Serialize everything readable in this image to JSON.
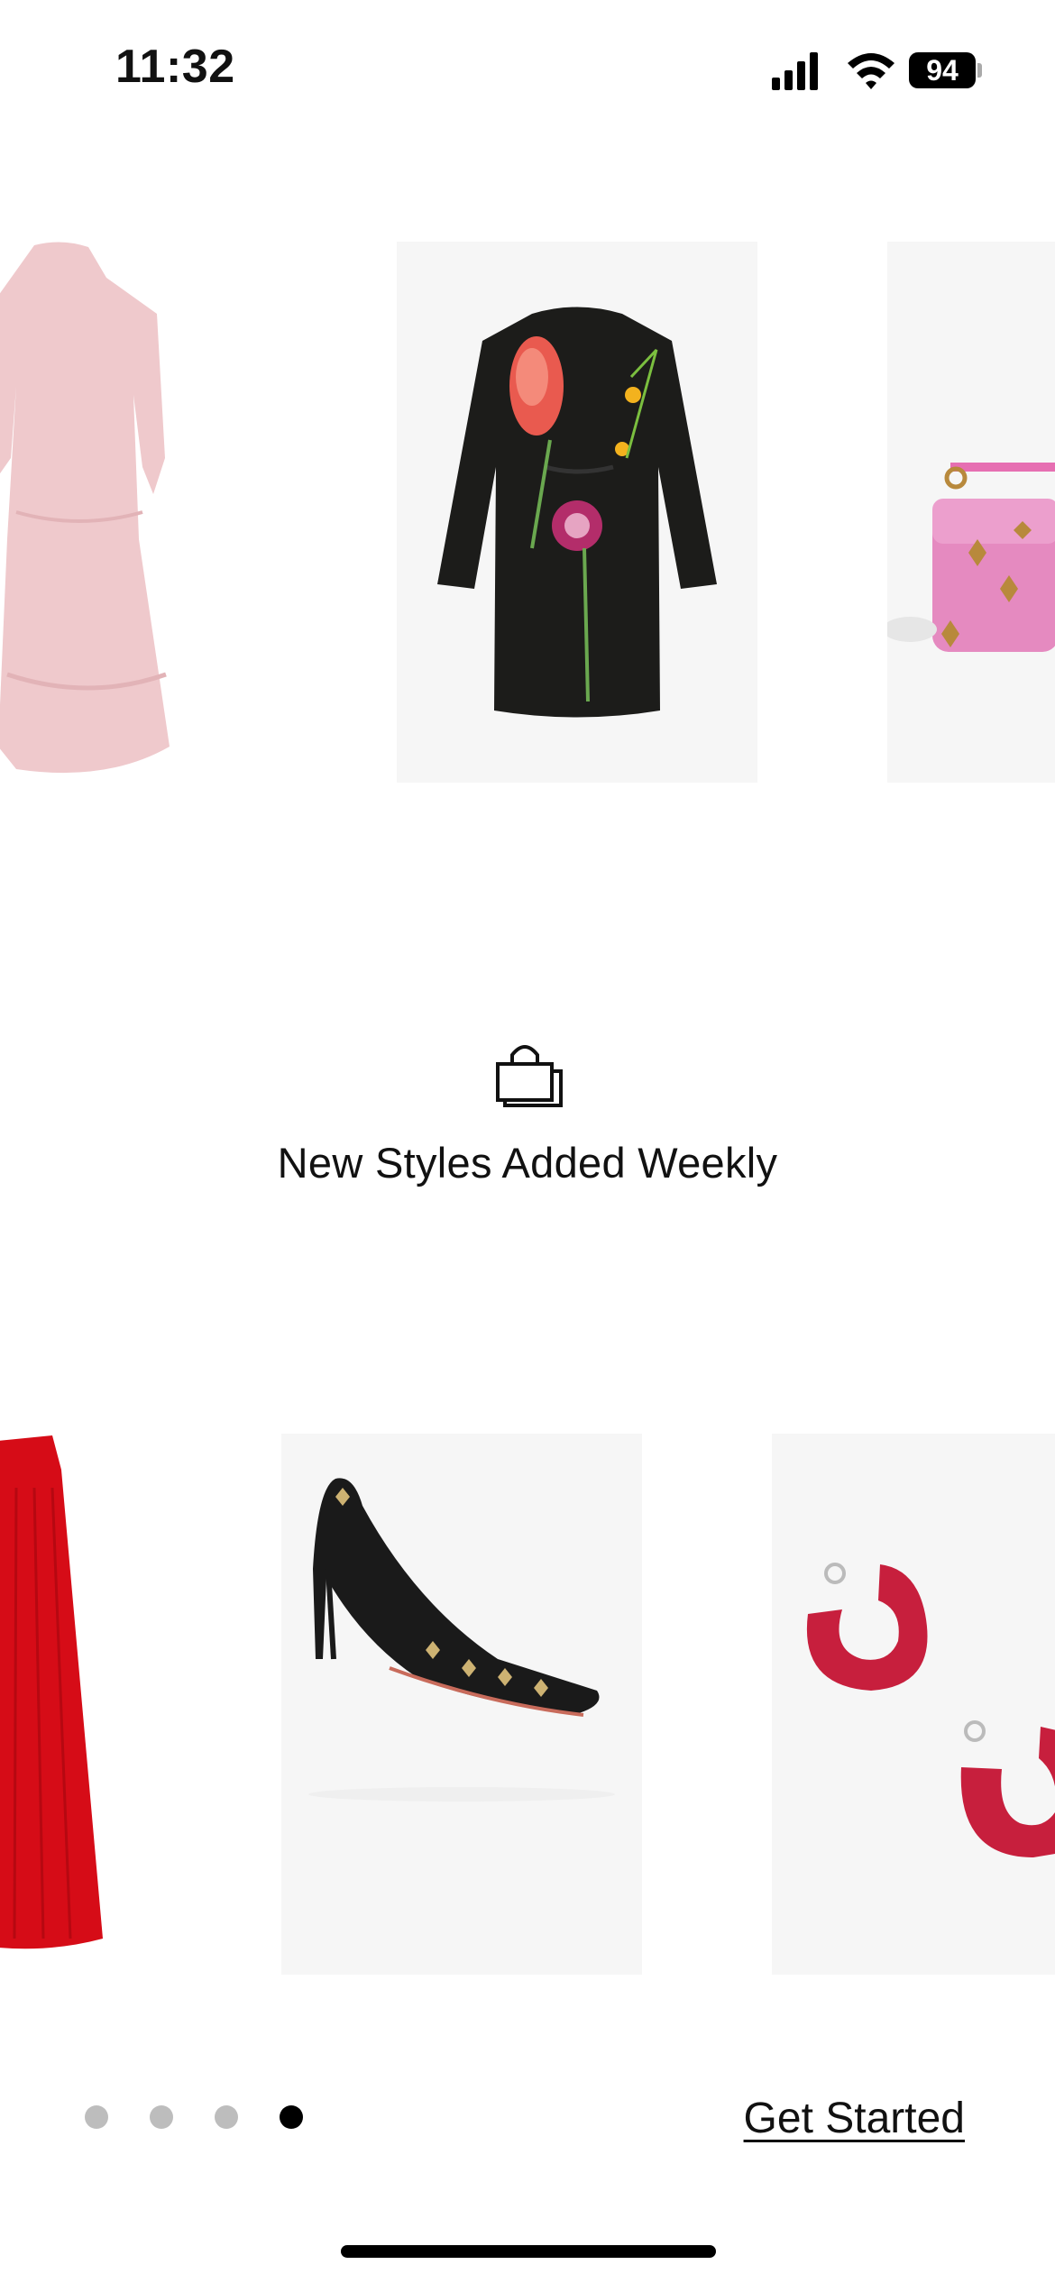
{
  "status": {
    "time": "11:32",
    "battery": "94"
  },
  "products": {
    "top": [
      {
        "name": "pink-lace-dress"
      },
      {
        "name": "black-floral-dress"
      },
      {
        "name": "pink-studded-bag"
      }
    ],
    "bottom": [
      {
        "name": "red-pleated-skirt"
      },
      {
        "name": "black-studded-pump"
      },
      {
        "name": "red-crystal-hoop-earrings"
      }
    ]
  },
  "onboarding": {
    "icon": "shopping-bags-icon",
    "headline": "New Styles Added Weekly",
    "page_count": 4,
    "active_page": 4,
    "cta_label": "Get Started"
  },
  "colors": {
    "active_dot": "#000000",
    "inactive_dot": "#bdbdbd",
    "tile_background": "#f6f6f6"
  }
}
